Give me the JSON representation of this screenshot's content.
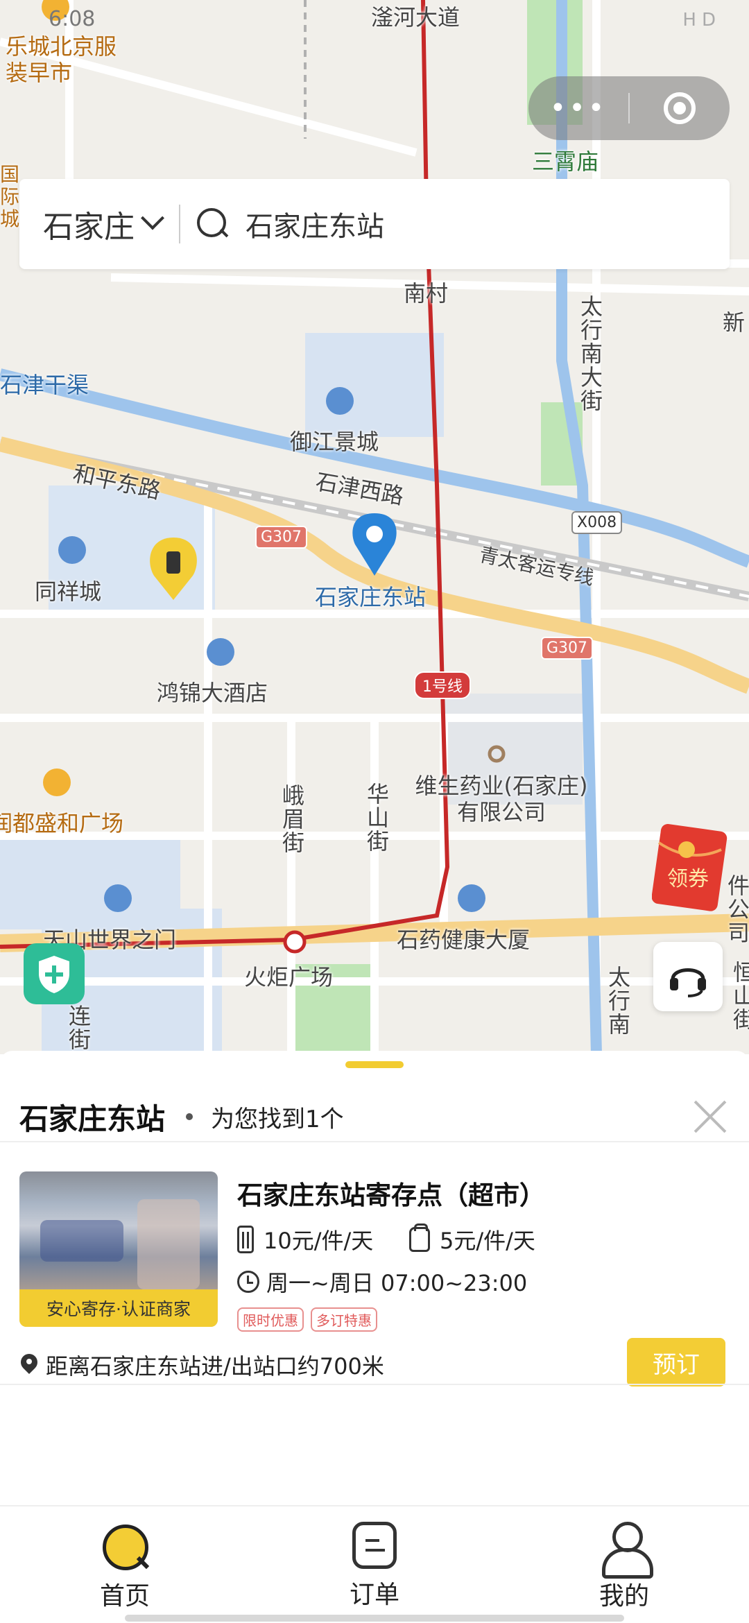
{
  "status_bar": {
    "time": "6:08",
    "icons": "HD"
  },
  "capsule": {
    "more_label": "•••"
  },
  "search": {
    "city": "石家庄",
    "query": "石家庄东站"
  },
  "map": {
    "labels": {
      "top_road": "滏河大道",
      "le_cheng": "乐城北京服装早市",
      "guoji": "国际城",
      "san_xiao_miao": "三霄庙",
      "nan_cun": "南村",
      "xin": "新",
      "shi_jin_gan_qu": "石津干渠",
      "taihang_nan_da_jie": "太行南大街",
      "yu_jiang_jing_cheng": "御江景城",
      "he_ping_dong_lu": "和平东路",
      "shi_jin_xi_lu": "石津西路",
      "qing_tai": "青太客运专线",
      "tong_xiang_cheng": "同祥城",
      "shijiazhuang_east": "石家庄东站",
      "hong_jin": "鸿锦大酒店",
      "e_mei_jie": "峨眉街",
      "hua_shan_jie": "华山街",
      "wei_sheng": "维生药业(石家庄)有限公司",
      "du_sheng_he": "润都盛和广场",
      "tian_shan": "天山世界之门",
      "huo_ju": "火炬广场",
      "shi_yao": "石药健康大厦",
      "lian": "连街",
      "taihang_nan2": "太行南",
      "heng_shan": "恒山街",
      "jian_gong": "件公司"
    },
    "badges": {
      "x008": "X008",
      "g307_a": "G307",
      "g307_b": "G307",
      "line1": "1号线"
    },
    "coupon_label": "领券"
  },
  "sheet": {
    "title": "石家庄东站",
    "count": "为您找到1个"
  },
  "store": {
    "name": "石家庄东站寄存点（超市）",
    "badge": "安心寄存·认证商家",
    "price_luggage": "10元/件/天",
    "price_bag": "5元/件/天",
    "hours": "周一~周日 07:00~23:00",
    "tags": [
      "限时优惠",
      "多订特惠"
    ],
    "distance": "距离石家庄东站进/出站口约700米",
    "book_label": "预订"
  },
  "tabs": {
    "home": "首页",
    "orders": "订单",
    "mine": "我的"
  },
  "colors": {
    "accent": "#f3cd35",
    "route": "#c62828",
    "shield": "#2ebd97"
  }
}
